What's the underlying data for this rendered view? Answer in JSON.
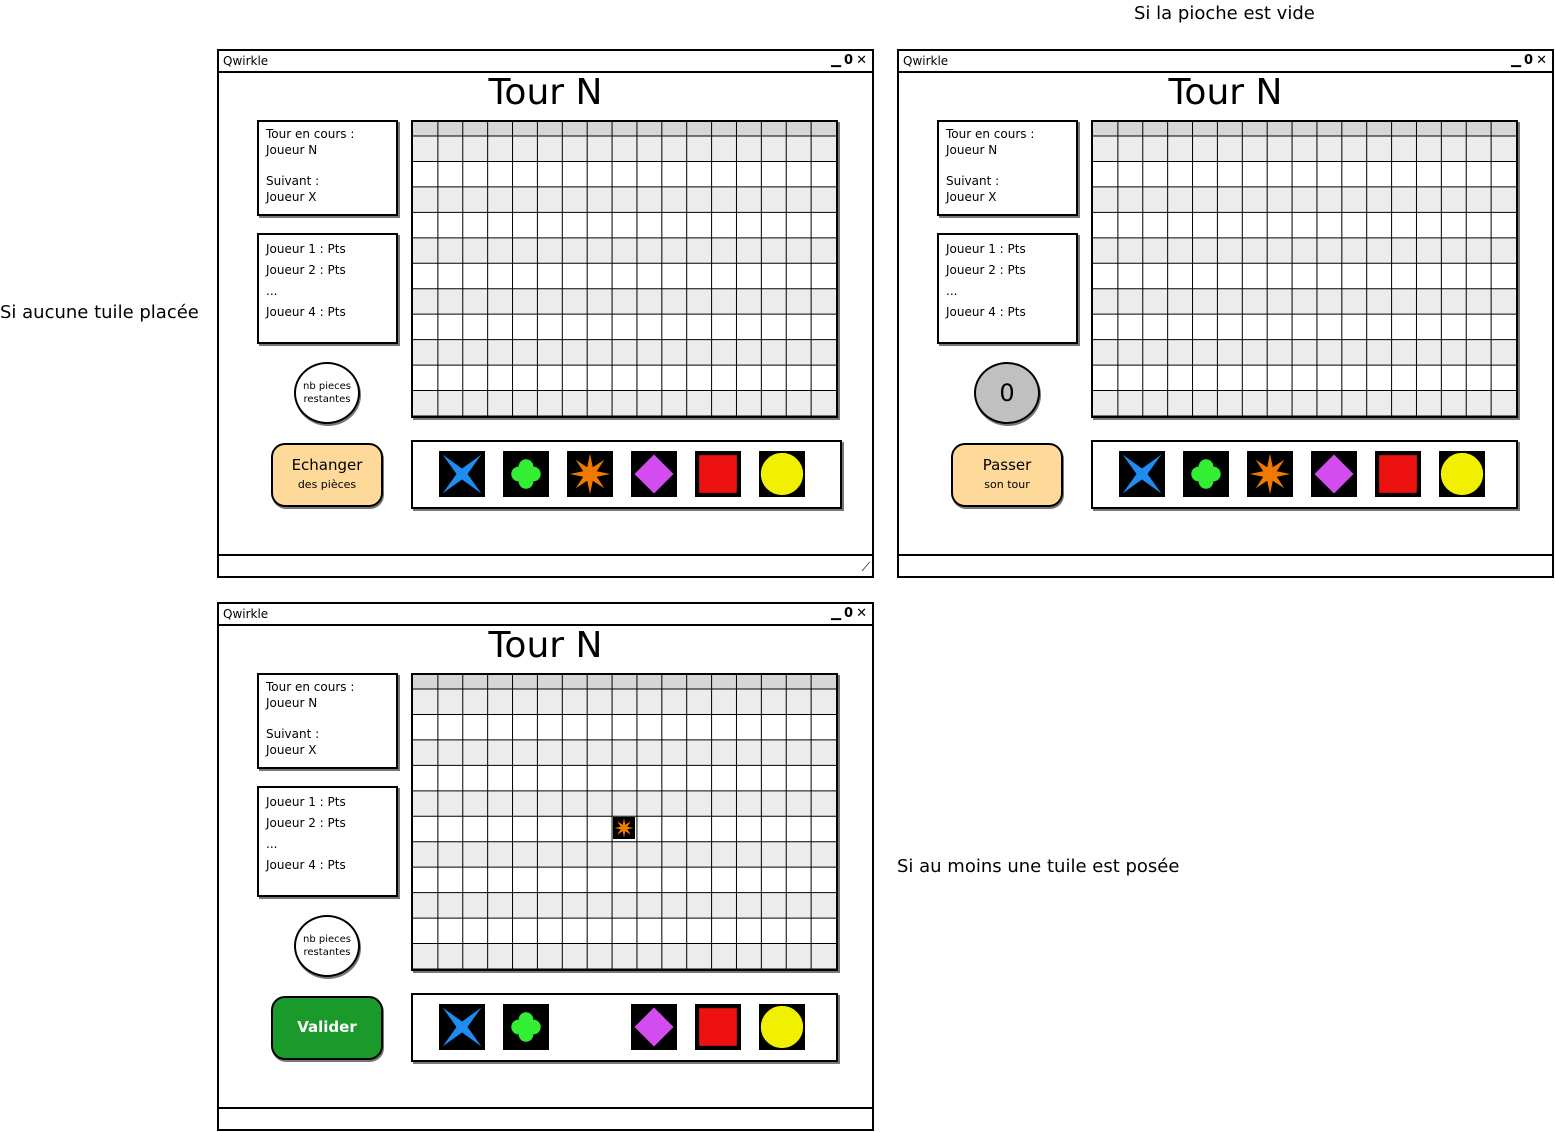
{
  "captions": {
    "no_tile_placed": "Si aucune tuile placée",
    "empty_draw_pile": "Si la pioche est vide",
    "at_least_one_tile": "Si au moins une tuile est posée"
  },
  "window_app_title": "Qwirkle",
  "window_controls": {
    "minimize": "▁",
    "maximize": "0",
    "close": "✕"
  },
  "turn_title": "Tour N",
  "turn_info": {
    "current_label": "Tour en cours :",
    "current_player": "Joueur N",
    "next_label": "Suivant :",
    "next_player": "Joueur X"
  },
  "scores": {
    "player1": "Joueur 1 : Pts",
    "player2": "Joueur 2 : Pts",
    "ellipsis": "...",
    "player4": "Joueur 4 : Pts"
  },
  "pieces_remaining": {
    "line1": "nb pieces",
    "line2": "restantes",
    "empty_count": "0"
  },
  "buttons": {
    "exchange_line1": "Echanger",
    "exchange_line2": "des pièces",
    "pass_line1": "Passer",
    "pass_line2": "son tour",
    "validate": "Valider"
  },
  "board": {
    "columns": 17,
    "rows": 11,
    "header_color": "#d6d6d6",
    "stripe_color": "#ececec"
  },
  "tiles": [
    {
      "shape": "star4",
      "color": "#1e8cf0"
    },
    {
      "shape": "clover",
      "color": "#33ee33"
    },
    {
      "shape": "starburst",
      "color": "#f07a00"
    },
    {
      "shape": "diamond",
      "color": "#d24cf0"
    },
    {
      "shape": "square",
      "color": "#ee1111"
    },
    {
      "shape": "circle",
      "color": "#f0f000"
    }
  ],
  "placed_tile": {
    "shape": "starburst",
    "color": "#f07a00",
    "col": 8,
    "row": 5
  }
}
